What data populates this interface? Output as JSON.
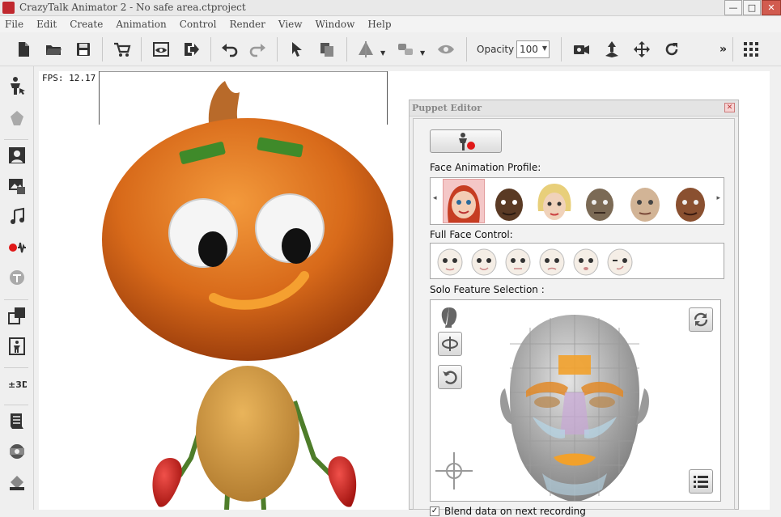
{
  "window": {
    "title": "CrazyTalk Animator 2   - No safe area.ctproject",
    "minimize": "—",
    "maximize": "□",
    "close": "✕"
  },
  "menu": [
    "File",
    "Edit",
    "Create",
    "Animation",
    "Control",
    "Render",
    "View",
    "Window",
    "Help"
  ],
  "toolbar": {
    "opacity_label": "Opacity :",
    "opacity_value": "100",
    "more": "»"
  },
  "canvas": {
    "fps": "FPS:  12.17"
  },
  "puppet_editor": {
    "title": "Puppet Editor",
    "close": "✕",
    "face_profile_label": "Face Animation Profile:",
    "full_face_label": "Full Face Control:",
    "solo_label": "Solo Feature Selection :",
    "blend_label": "Blend data on next recording",
    "blend_checked": true,
    "profile_arrow_left": "◂",
    "profile_arrow_right": "▸"
  },
  "colors": {
    "accent_red": "#c0282e",
    "record_dot": "#e01818",
    "selected_profile": "#f4c7c7"
  }
}
